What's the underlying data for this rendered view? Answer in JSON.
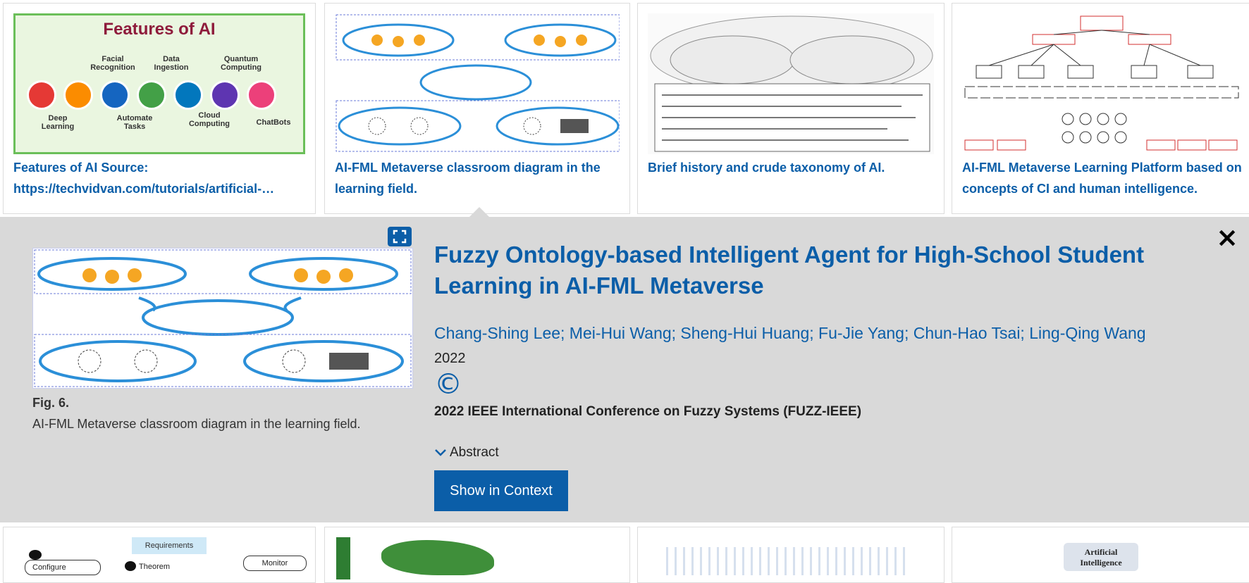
{
  "results": [
    {
      "caption": "Features of AI Source: https://techvidvan.com/tutorials/artificial-intelligence-features/",
      "thumb": {
        "heading": "Features of AI",
        "labels": [
          "Facial Recognition",
          "Data Ingestion",
          "Quantum Computing",
          "Deep Learning",
          "Automate Tasks",
          "Cloud Computing",
          "ChatBots"
        ],
        "colors": [
          "#e53935",
          "#fb8c00",
          "#1565c0",
          "#43a047",
          "#0277bd",
          "#5e35b1",
          "#ec407a"
        ]
      }
    },
    {
      "caption": "AI-FML Metaverse classroom diagram in the learning field."
    },
    {
      "caption": "Brief history and crude taxonomy of AI."
    },
    {
      "caption": "AI-FML Metaverse Learning Platform based on concepts of CI and human intelligence."
    }
  ],
  "detail": {
    "figure_label": "Fig. 6.",
    "figure_caption": "AI-FML Metaverse classroom diagram in the learning field.",
    "title": "Fuzzy Ontology-based Intelligent Agent for High-School Student Learning in AI-FML Metaverse",
    "authors": "Chang-Shing Lee; Mei-Hui Wang; Sheng-Hui Huang; Fu-Jie Yang; Chun-Hao Tsai; Ling-Qing Wang",
    "year": "2022",
    "copyright_symbol": "©",
    "conference": "2022 IEEE International Conference on Fuzzy Systems (FUZZ-IEEE)",
    "abstract_toggle": "Abstract",
    "show_in_context": "Show in Context",
    "close_glyph": "×"
  },
  "bottom_row": {
    "thumb1_labels": [
      "Requirements",
      "Configure",
      "Theorem",
      "Monitor"
    ],
    "thumb4_label": "Artificial Intelligence"
  },
  "colors": {
    "accent": "#0b5ea8",
    "panel_bg": "#d9d9d9",
    "card_border": "#dcdcdc"
  }
}
